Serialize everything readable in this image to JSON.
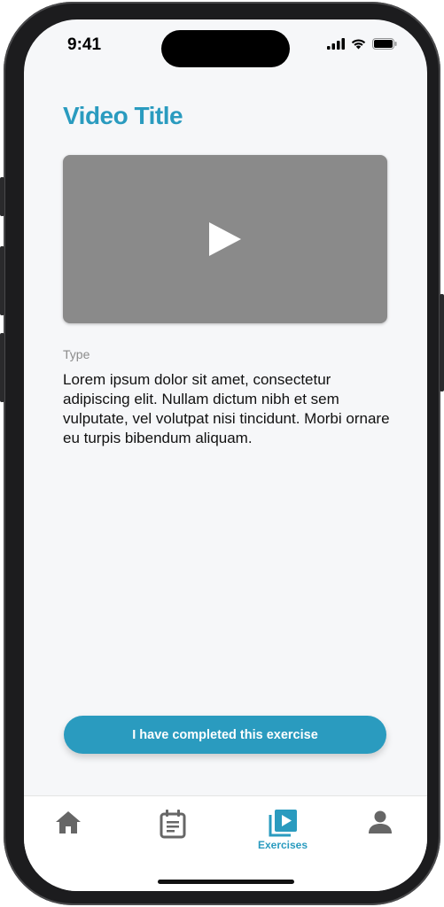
{
  "status_bar": {
    "time": "9:41"
  },
  "page": {
    "title": "Video Title",
    "type_label": "Type",
    "description": "Lorem ipsum dolor sit amet, consectetur adipiscing elit. Nullam dictum nibh et sem vulputate, vel volutpat nisi tincidunt. Morbi ornare eu turpis bibendum aliquam."
  },
  "actions": {
    "complete_label": "I have completed this exercise"
  },
  "tabbar": {
    "items": [
      {
        "icon": "home-icon",
        "label": ""
      },
      {
        "icon": "calendar-icon",
        "label": ""
      },
      {
        "icon": "exercises-icon",
        "label": "Exercises",
        "active": true
      },
      {
        "icon": "profile-icon",
        "label": ""
      }
    ]
  },
  "colors": {
    "accent": "#2a9bbf",
    "video_placeholder": "#8a8a8a",
    "tab_inactive": "#666666"
  }
}
